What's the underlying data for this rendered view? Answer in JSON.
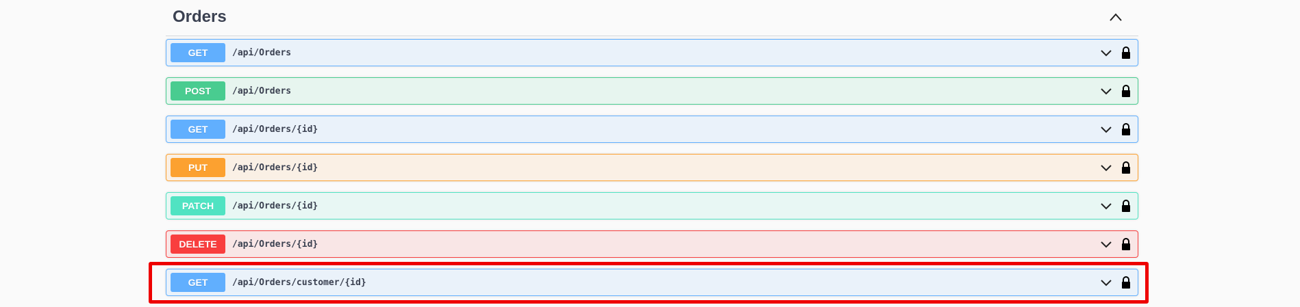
{
  "section": {
    "title": "Orders"
  },
  "operations": [
    {
      "method": "GET",
      "path": "/api/Orders",
      "kind": "get"
    },
    {
      "method": "POST",
      "path": "/api/Orders",
      "kind": "post"
    },
    {
      "method": "GET",
      "path": "/api/Orders/{id}",
      "kind": "get"
    },
    {
      "method": "PUT",
      "path": "/api/Orders/{id}",
      "kind": "put"
    },
    {
      "method": "PATCH",
      "path": "/api/Orders/{id}",
      "kind": "patch"
    },
    {
      "method": "DELETE",
      "path": "/api/Orders/{id}",
      "kind": "delete"
    },
    {
      "method": "GET",
      "path": "/api/Orders/customer/{id}",
      "kind": "get"
    }
  ],
  "icons": {
    "collapse": "chevron-up-icon",
    "expand": "chevron-down-icon",
    "lock": "lock-icon"
  },
  "colors": {
    "get": "#61affe",
    "post": "#49cc90",
    "put": "#fca130",
    "patch": "#50e3c2",
    "delete": "#f93e3e",
    "highlight": "#ee0000"
  }
}
